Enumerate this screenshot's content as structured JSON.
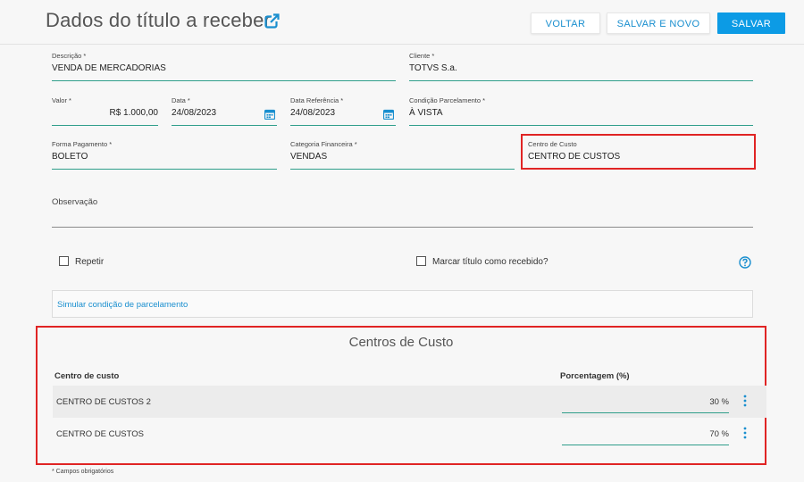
{
  "header": {
    "title": "Dados do título a receber",
    "buttons": {
      "voltar": "VOLTAR",
      "salvar_novo": "SALVAR E NOVO",
      "salvar": "SALVAR"
    }
  },
  "form": {
    "descricao": {
      "label": "Descrição *",
      "value": "VENDA DE MERCADORIAS"
    },
    "cliente": {
      "label": "Cliente *",
      "value": "TOTVS S.a."
    },
    "valor": {
      "label": "Valor *",
      "value": "R$ 1.000,00"
    },
    "data": {
      "label": "Data *",
      "value": "24/08/2023"
    },
    "data_referencia": {
      "label": "Data Referência *",
      "value": "24/08/2023"
    },
    "condicao": {
      "label": "Condição Parcelamento *",
      "value": "À VISTA"
    },
    "forma_pagamento": {
      "label": "Forma Pagamento *",
      "value": "BOLETO"
    },
    "categoria": {
      "label": "Categoria Financeira *",
      "value": "VENDAS"
    },
    "centro_custo": {
      "label": "Centro de Custo",
      "value": "CENTRO DE CUSTOS"
    },
    "observacao": {
      "label": "Observação",
      "value": ""
    }
  },
  "options": {
    "repetir": "Repetir",
    "marcar_recebido": "Marcar título como recebido?"
  },
  "simular": "Simular condição de parcelamento",
  "centros": {
    "title": "Centros de Custo",
    "col_centro": "Centro de custo",
    "col_pct": "Porcentagem (%)",
    "rows": [
      {
        "name": "CENTRO DE CUSTOS 2",
        "pct": "30 %"
      },
      {
        "name": "CENTRO DE CUSTOS",
        "pct": "70 %"
      }
    ]
  },
  "footnote": "* Campos obrigatórios",
  "colors": {
    "accent": "#0c9be5",
    "underline": "#2f9e8a",
    "highlight": "#e02424"
  },
  "icons": {
    "title": "external-link-icon",
    "calendar": "calendar-icon",
    "help": "help-circle-icon",
    "row_menu": "kebab-menu-icon"
  }
}
